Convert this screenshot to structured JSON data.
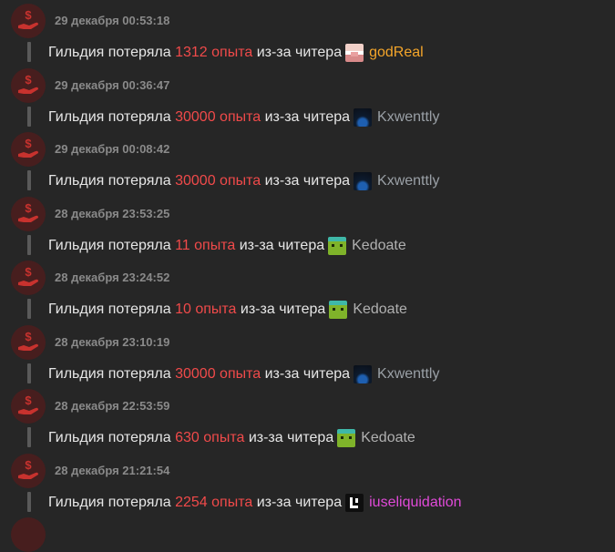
{
  "colors": {
    "amount": "#f04a4a",
    "timestamp": "#8a8a8a",
    "text": "#e6e6e6",
    "icon_red": "#c8322e",
    "icon_bg": "#471e1e"
  },
  "text": {
    "prefix": "Гильдия потеряла",
    "unit": "опыта",
    "middle": "из-за читера"
  },
  "entries": [
    {
      "time": "29 декабря 00:53:18",
      "amount": "1312",
      "player": "godReal",
      "player_color": "#f4a52a",
      "head": "pig"
    },
    {
      "time": "29 декабря 00:36:47",
      "amount": "30000",
      "player": "Kxwenttly",
      "player_color": "#9aa0a6",
      "head": "dark"
    },
    {
      "time": "29 декабря 00:08:42",
      "amount": "30000",
      "player": "Kxwenttly",
      "player_color": "#9aa0a6",
      "head": "dark"
    },
    {
      "time": "28 декабря 23:53:25",
      "amount": "11",
      "player": "Kedoate",
      "player_color": "#b0b0b0",
      "head": "zombie"
    },
    {
      "time": "28 декабря 23:24:52",
      "amount": "10",
      "player": "Kedoate",
      "player_color": "#b0b0b0",
      "head": "zombie"
    },
    {
      "time": "28 декабря 23:10:19",
      "amount": "30000",
      "player": "Kxwenttly",
      "player_color": "#9aa0a6",
      "head": "dark"
    },
    {
      "time": "28 декабря 22:53:59",
      "amount": "630",
      "player": "Kedoate",
      "player_color": "#b0b0b0",
      "head": "zombie"
    },
    {
      "time": "28 декабря 21:21:54",
      "amount": "2254",
      "player": "iuseliquidation",
      "player_color": "#e04ad8",
      "head": "logo"
    }
  ]
}
